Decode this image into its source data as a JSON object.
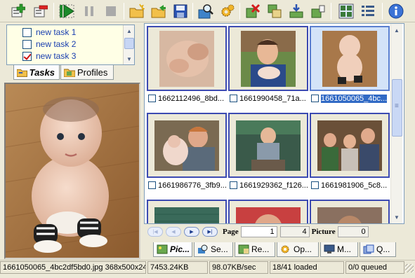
{
  "toolbar": {
    "buttons": [
      {
        "name": "add-task-icon",
        "color": "#2d9c2d"
      },
      {
        "name": "remove-task-icon",
        "color": "#c62020"
      },
      {
        "name": "play-icon",
        "color": "#1c8a2a"
      },
      {
        "name": "pause-icon",
        "color": "#9a9a9a"
      },
      {
        "name": "stop-icon",
        "color": "#9a9a9a"
      },
      {
        "name": "new-folder-icon"
      },
      {
        "name": "open-folder-icon"
      },
      {
        "name": "save-icon"
      },
      {
        "name": "search-icon"
      },
      {
        "name": "settings-icon"
      },
      {
        "name": "delete-picture-icon"
      },
      {
        "name": "copy-picture-icon"
      },
      {
        "name": "download-picture-icon"
      },
      {
        "name": "export-picture-icon"
      },
      {
        "name": "grid-view-icon"
      },
      {
        "name": "list-view-icon"
      },
      {
        "name": "info-icon"
      }
    ]
  },
  "tasks": [
    {
      "label": "new task 1",
      "checked": false
    },
    {
      "label": "new task 2",
      "checked": false
    },
    {
      "label": "new task 3",
      "checked": true
    }
  ],
  "left_tabs": [
    {
      "label": "Tasks",
      "active": true
    },
    {
      "label": "Profiles",
      "active": false
    }
  ],
  "thumbnails": [
    {
      "caption": "1662112496_8bd...",
      "selected": false
    },
    {
      "caption": "1661990458_71a...",
      "selected": false
    },
    {
      "caption": "1661050065_4bc...",
      "selected": true
    },
    {
      "caption": "1661986776_3fb9...",
      "selected": false
    },
    {
      "caption": "1661929362_f126...",
      "selected": false
    },
    {
      "caption": "1661981906_5c8...",
      "selected": false
    },
    {
      "caption": "",
      "selected": false
    },
    {
      "caption": "",
      "selected": false
    },
    {
      "caption": "",
      "selected": false
    }
  ],
  "pager": {
    "page_label": "Page",
    "page_value": "1",
    "page_total": "4",
    "picture_label": "Picture",
    "picture_value": "0"
  },
  "bottom_tabs": [
    {
      "label": "Pic...",
      "icon": "pictures-icon",
      "active": true
    },
    {
      "label": "Se...",
      "icon": "search-tab-icon",
      "active": false
    },
    {
      "label": "Re...",
      "icon": "results-icon",
      "active": false
    },
    {
      "label": "Op...",
      "icon": "options-icon",
      "active": false
    },
    {
      "label": "M...",
      "icon": "monitor-icon",
      "active": false
    },
    {
      "label": "Q...",
      "icon": "queue-icon",
      "active": false
    }
  ],
  "status": {
    "file": "1661050065_4bc2df5bd0.jpg 368x500x24",
    "size": "7453.24KB",
    "speed": "98.07KB/sec",
    "loaded": "18/41 loaded",
    "queued": "0/0 queued"
  },
  "colors": {
    "accent": "#316ac5",
    "frame": "#3c4ab2",
    "selected_bg": "#d3e3f8"
  }
}
